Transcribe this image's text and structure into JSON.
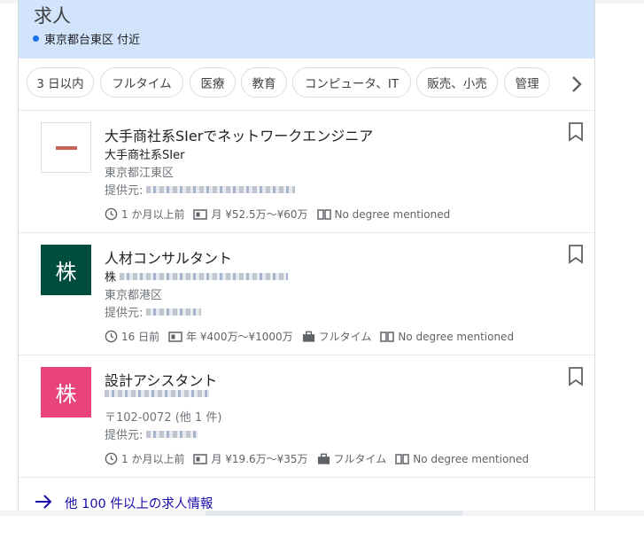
{
  "header": {
    "title": "求人",
    "location": "東京都台東区 付近",
    "accent_color": "#1a73e8",
    "bg_color": "#d2e3fc"
  },
  "chips": [
    {
      "label": "3 日以内"
    },
    {
      "label": "フルタイム"
    },
    {
      "label": "医療"
    },
    {
      "label": "教育"
    },
    {
      "label": "コンピュータ、IT"
    },
    {
      "label": "販売、小売"
    },
    {
      "label": "管理"
    }
  ],
  "chips_next_icon": "chevron-right-icon",
  "jobs": [
    {
      "title": "大手商社系SIerでネットワークエンジニア",
      "company": "大手商社系SIer",
      "location": "東京都江東区",
      "source_label": "提供元:",
      "posted": "1 か月以上前",
      "salary": "月 ¥52.5万～¥60万",
      "degree": "No degree mentioned",
      "logo_text": "",
      "logo_color": "#ffffff"
    },
    {
      "title": "人材コンサルタント",
      "company": "株",
      "location": "東京都港区",
      "source_label": "提供元:",
      "posted": "16 日前",
      "salary": "年 ¥400万～¥1000万",
      "type": "フルタイム",
      "degree": "No degree mentioned",
      "logo_text": "株",
      "logo_color": "#004d40"
    },
    {
      "title": "設計アシスタント",
      "company": "",
      "location": "〒102-0072 (他 1 件)",
      "source_label": "提供元:",
      "posted": "1 か月以上前",
      "salary": "月 ¥19.6万～¥35万",
      "type": "フルタイム",
      "degree": "No degree mentioned",
      "logo_text": "株",
      "logo_color": "#e8437a"
    }
  ],
  "more": {
    "label": "他 100 件以上の求人情報"
  }
}
